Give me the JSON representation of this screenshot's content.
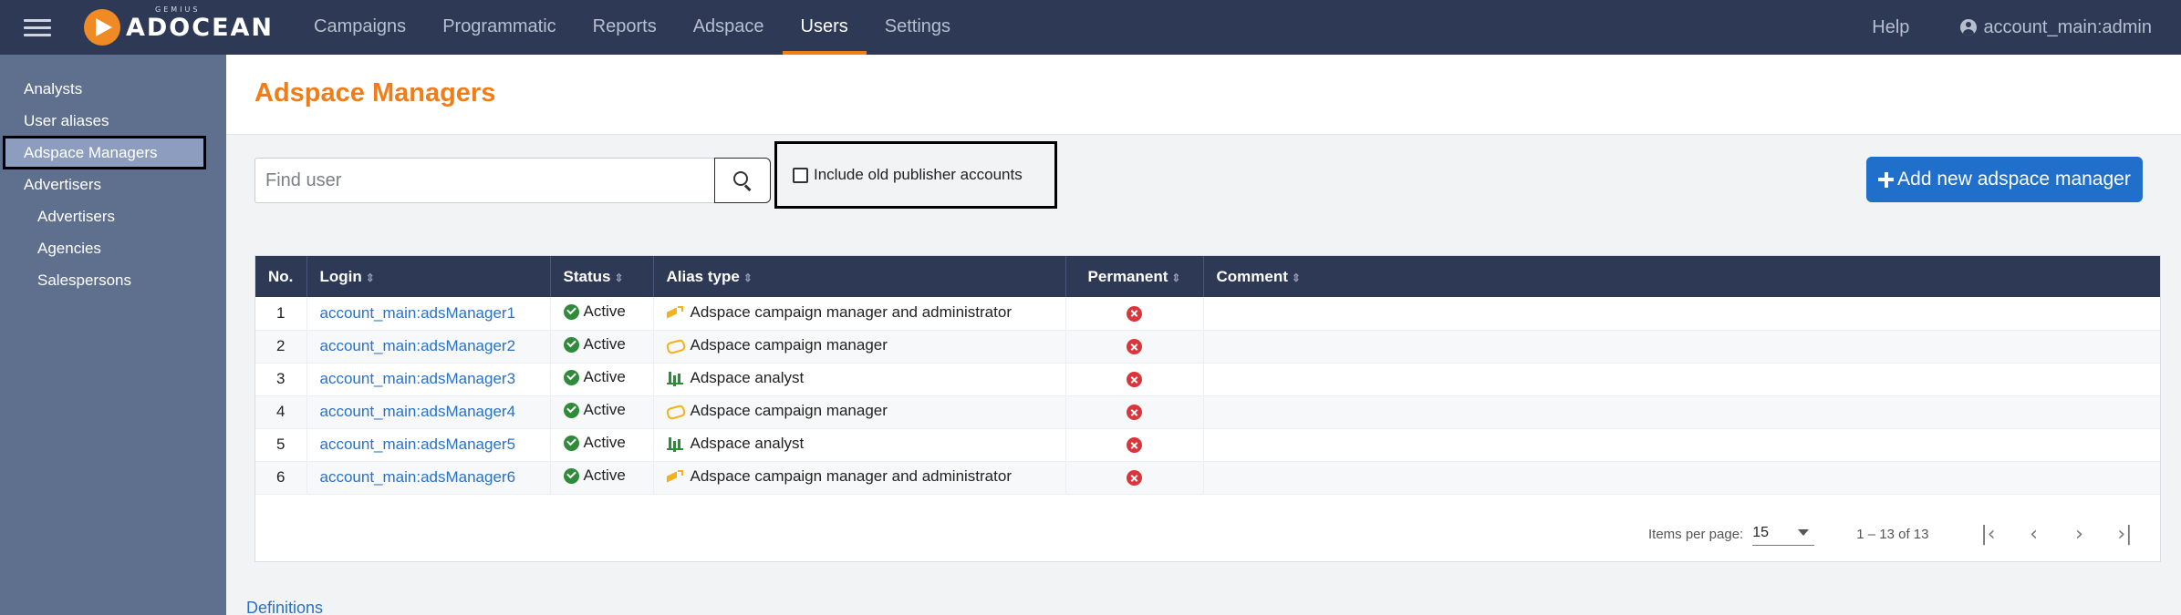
{
  "topbar": {
    "logo_text": "ADOCEAN",
    "logo_sub": "GEMIUS",
    "nav": [
      "Campaigns",
      "Programmatic",
      "Reports",
      "Adspace",
      "Users",
      "Settings"
    ],
    "active_nav": "Users",
    "help": "Help",
    "account": "account_main:admin"
  },
  "sidebar": {
    "items": [
      {
        "label": "Analysts",
        "level": 0
      },
      {
        "label": "User aliases",
        "level": 0
      },
      {
        "label": "Adspace Managers",
        "level": 0
      },
      {
        "label": "Advertisers",
        "level": 0
      },
      {
        "label": "Advertisers",
        "level": 1
      },
      {
        "label": "Agencies",
        "level": 1
      },
      {
        "label": "Salespersons",
        "level": 1
      }
    ],
    "active": "Adspace Managers"
  },
  "page": {
    "title": "Adspace Managers"
  },
  "toolbar": {
    "search_placeholder": "Find user",
    "search_value": "",
    "include_old_label": "Include old publisher accounts",
    "include_old_checked": false,
    "add_button_label": "Add new adspace manager"
  },
  "table": {
    "headers": {
      "no": "No.",
      "login": "Login",
      "status": "Status",
      "alias_type": "Alias type",
      "permanent": "Permanent",
      "comment": "Comment"
    },
    "rows": [
      {
        "no": "1",
        "login": "account_main:adsManager1",
        "status": "Active",
        "alias_type": "Adspace campaign manager and administrator",
        "alias_icon": "megaphone-icon",
        "permanent": false,
        "comment": ""
      },
      {
        "no": "2",
        "login": "account_main:adsManager2",
        "status": "Active",
        "alias_type": "Adspace campaign manager",
        "alias_icon": "ticket-icon",
        "permanent": false,
        "comment": ""
      },
      {
        "no": "3",
        "login": "account_main:adsManager3",
        "status": "Active",
        "alias_type": "Adspace analyst",
        "alias_icon": "chart-icon",
        "permanent": false,
        "comment": ""
      },
      {
        "no": "4",
        "login": "account_main:adsManager4",
        "status": "Active",
        "alias_type": "Adspace campaign manager",
        "alias_icon": "ticket-icon",
        "permanent": false,
        "comment": ""
      },
      {
        "no": "5",
        "login": "account_main:adsManager5",
        "status": "Active",
        "alias_type": "Adspace analyst",
        "alias_icon": "chart-icon",
        "permanent": false,
        "comment": ""
      },
      {
        "no": "6",
        "login": "account_main:adsManager6",
        "status": "Active",
        "alias_type": "Adspace campaign manager and administrator",
        "alias_icon": "megaphone-icon",
        "permanent": false,
        "comment": ""
      }
    ]
  },
  "pagination": {
    "items_per_page_label": "Items per page:",
    "items_per_page": "15",
    "range": "1 – 13 of 13"
  },
  "footer": {
    "definitions": "Definitions"
  },
  "colors": {
    "topbar": "#2e3a55",
    "sidebar": "#5f6f8e",
    "accent": "#f07d18",
    "primary_button": "#1f6fcb",
    "link": "#2a72c4",
    "status_active": "#2f8a3a",
    "permanent_false": "#d9353a"
  }
}
